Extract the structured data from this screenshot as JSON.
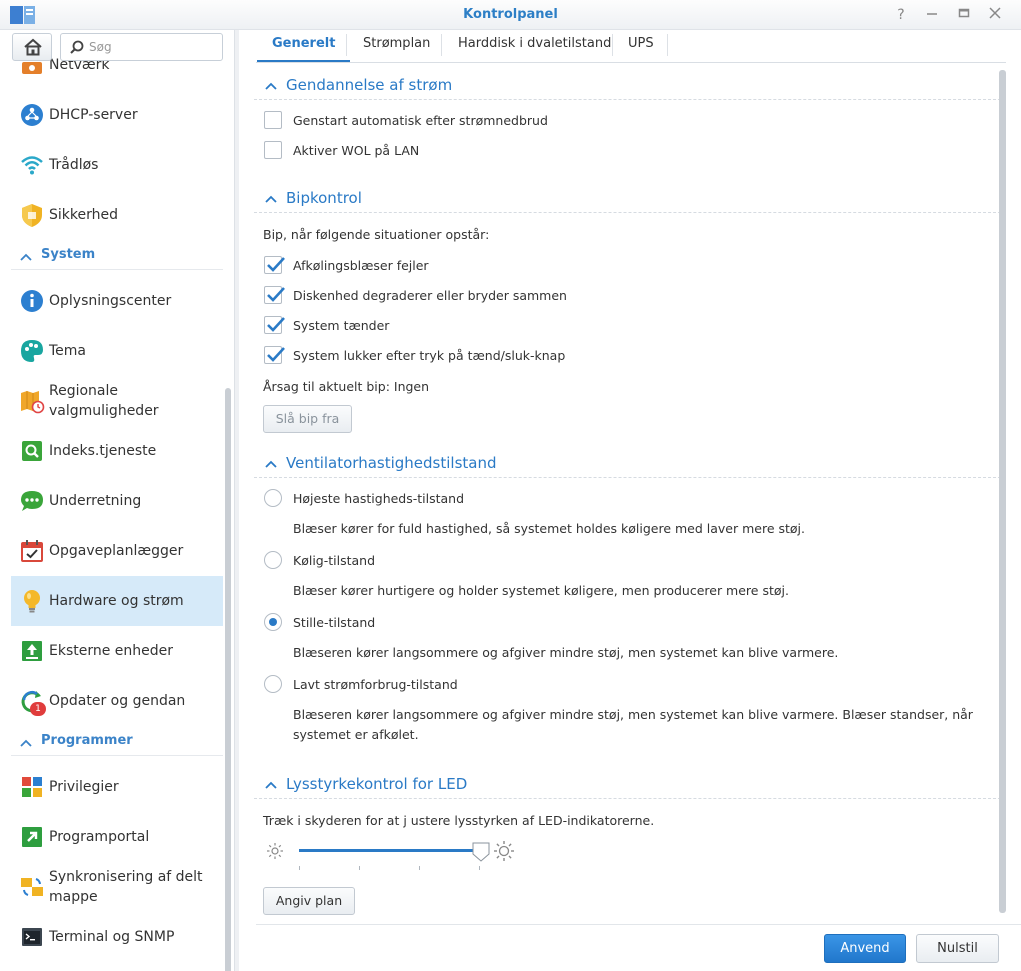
{
  "window": {
    "title": "Kontrolpanel"
  },
  "search": {
    "placeholder": "Søg"
  },
  "sidebar": {
    "items_top": [
      {
        "label": "Netværk"
      },
      {
        "label": "DHCP-server"
      },
      {
        "label": "Trådløs"
      },
      {
        "label": "Sikkerhed"
      }
    ],
    "section_system": "System",
    "items_system": [
      {
        "label": "Oplysningscenter"
      },
      {
        "label": "Tema"
      },
      {
        "label": "Regionale valgmuligheder"
      },
      {
        "label": "Indeks.tjeneste"
      },
      {
        "label": "Underretning"
      },
      {
        "label": "Opgaveplanlægger"
      },
      {
        "label": "Hardware og strøm"
      },
      {
        "label": "Eksterne enheder"
      },
      {
        "label": "Opdater og gendan",
        "badge": "1"
      }
    ],
    "section_programmer": "Programmer",
    "items_programmer": [
      {
        "label": "Privilegier"
      },
      {
        "label": "Programportal"
      },
      {
        "label": "Synkronisering af delt mappe"
      },
      {
        "label": "Terminal og SNMP"
      }
    ]
  },
  "tabs": [
    "Generelt",
    "Strømplan",
    "Harddisk i dvaletilstand",
    "UPS"
  ],
  "power_recovery": {
    "title": "Gendannelse af strøm",
    "options": [
      {
        "label": "Genstart automatisk efter strømnedbrud",
        "checked": false
      },
      {
        "label": "Aktiver WOL på LAN",
        "checked": false
      }
    ]
  },
  "beep": {
    "title": "Bipkontrol",
    "intro": "Bip, når følgende situationer opstår:",
    "options": [
      {
        "label": "Afkølingsblæser fejler",
        "checked": true
      },
      {
        "label": "Diskenhed degraderer eller bryder sammen",
        "checked": true
      },
      {
        "label": "System tænder",
        "checked": true
      },
      {
        "label": "System lukker efter tryk på tænd/sluk-knap",
        "checked": true
      }
    ],
    "reason": "Årsag til aktuelt bip: Ingen",
    "mute_button": "Slå bip fra"
  },
  "fan": {
    "title": "Ventilatorhastighedstilstand",
    "modes": [
      {
        "label": "Højeste hastigheds-tilstand",
        "desc": "Blæser kører for fuld hastighed, så systemet holdes køligere med laver mere støj.",
        "selected": false
      },
      {
        "label": "Kølig-tilstand",
        "desc": "Blæser kører hurtigere og holder systemet køligere, men producerer mere støj.",
        "selected": false
      },
      {
        "label": "Stille-tilstand",
        "desc": "Blæseren kører langsommere og afgiver mindre støj, men systemet kan blive varmere.",
        "selected": true
      },
      {
        "label": "Lavt strømforbrug-tilstand",
        "desc": "Blæseren kører langsommere og afgiver mindre støj, men systemet kan blive varmere. Blæser standser, når systemet er afkølet.",
        "selected": false
      }
    ]
  },
  "led": {
    "title": "Lysstyrkekontrol for LED",
    "desc": "Træk i skyderen for at j ustere lysstyrken af LED-indikatorerne.",
    "brightness_level": 1.0,
    "schedule_button": "Angiv plan"
  },
  "footer": {
    "apply": "Anvend",
    "reset": "Nulstil"
  },
  "colors": {
    "accent": "#2a7ac6",
    "active_bg": "#d6eaf9",
    "primary_button": "#2a80d2"
  }
}
